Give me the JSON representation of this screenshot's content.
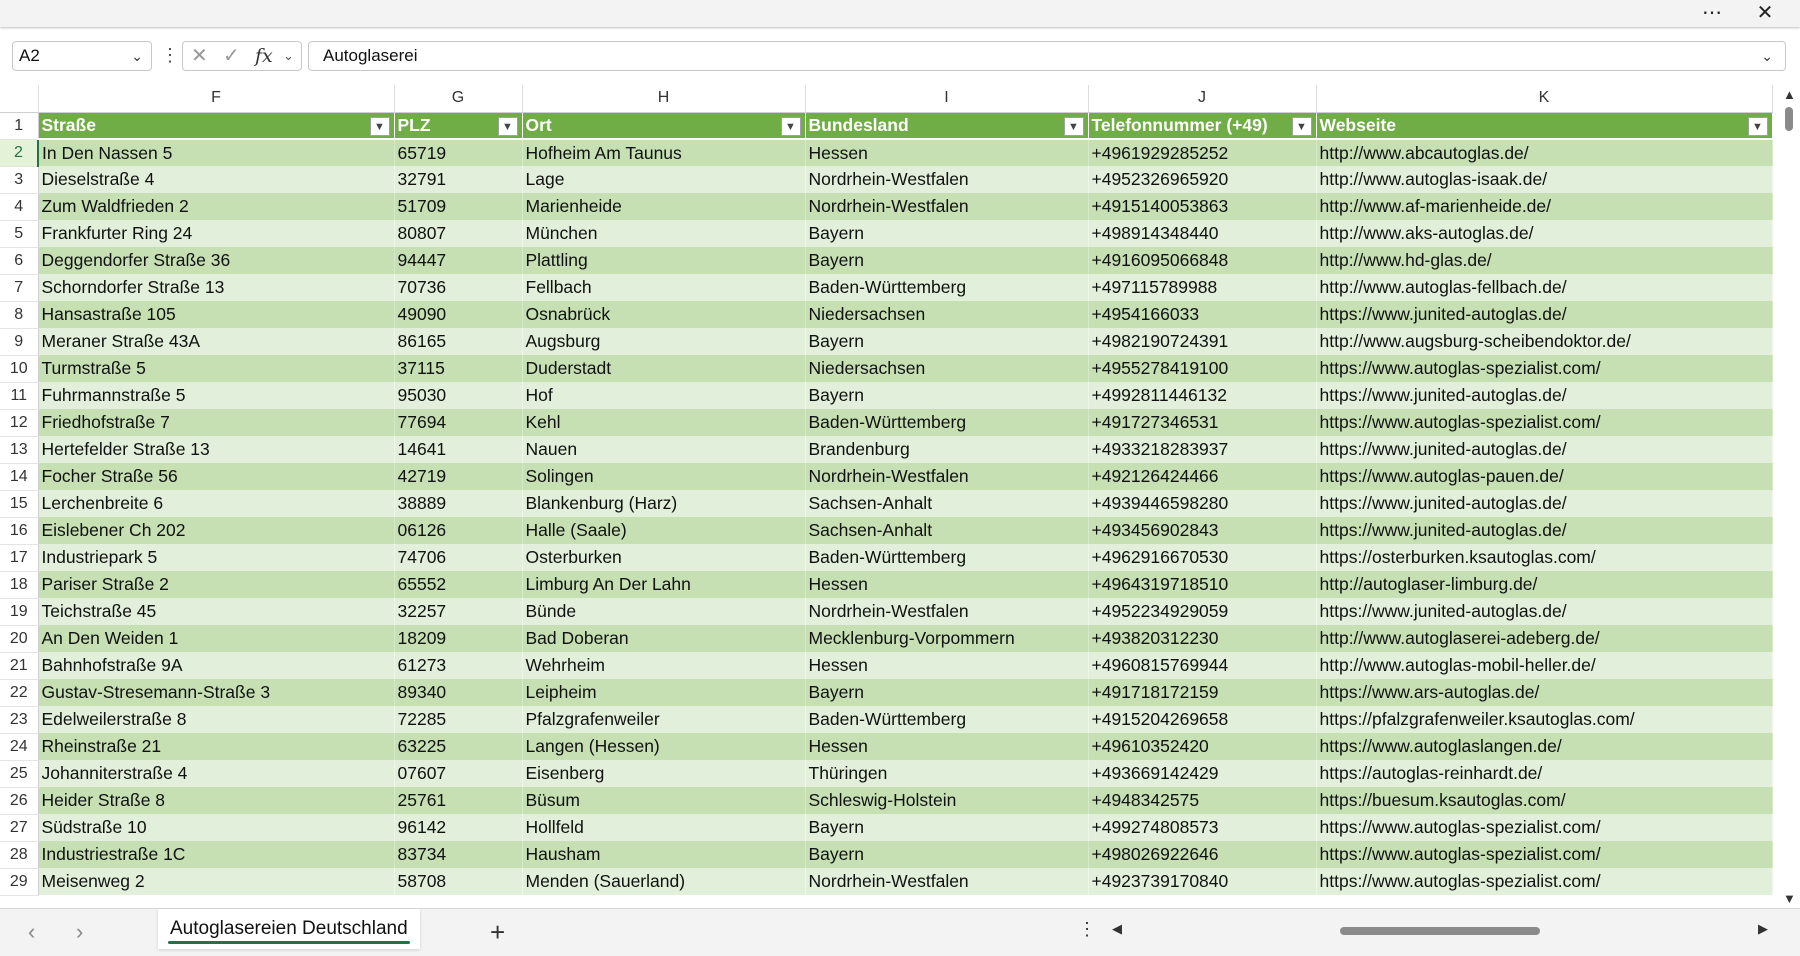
{
  "window": {
    "more_icon": "more-horizontal-icon",
    "close_icon": "close-icon"
  },
  "formula_bar": {
    "name_box": "A2",
    "cancel_icon": "cancel-x-icon",
    "confirm_icon": "checkmark-icon",
    "fx_label": "fx",
    "content": "Autoglaserei"
  },
  "columns": [
    "F",
    "G",
    "H",
    "I",
    "J",
    "K"
  ],
  "headers": [
    "Straße",
    "PLZ",
    "Ort",
    "Bundesland",
    "Telefonnummer (+49)",
    "Webseite"
  ],
  "rows": [
    {
      "n": "2",
      "c": [
        "In Den Nassen 5",
        "65719",
        "Hofheim Am Taunus",
        "Hessen",
        "+4961929285252",
        "http://www.abcautoglas.de/"
      ]
    },
    {
      "n": "3",
      "c": [
        "Dieselstraße 4",
        "32791",
        "Lage",
        "Nordrhein-Westfalen",
        "+4952326965920",
        "http://www.autoglas-isaak.de/"
      ]
    },
    {
      "n": "4",
      "c": [
        "Zum Waldfrieden 2",
        "51709",
        "Marienheide",
        "Nordrhein-Westfalen",
        "+4915140053863",
        "http://www.af-marienheide.de/"
      ]
    },
    {
      "n": "5",
      "c": [
        "Frankfurter Ring 24",
        "80807",
        "München",
        "Bayern",
        "+498914348440",
        "http://www.aks-autoglas.de/"
      ]
    },
    {
      "n": "6",
      "c": [
        "Deggendorfer Straße 36",
        "94447",
        "Plattling",
        "Bayern",
        "+4916095066848",
        "http://www.hd-glas.de/"
      ]
    },
    {
      "n": "7",
      "c": [
        "Schorndorfer Straße 13",
        "70736",
        "Fellbach",
        "Baden-Württemberg",
        "+497115789988",
        "http://www.autoglas-fellbach.de/"
      ]
    },
    {
      "n": "8",
      "c": [
        "Hansastraße 105",
        "49090",
        "Osnabrück",
        "Niedersachsen",
        "+4954166033",
        "https://www.junited-autoglas.de/"
      ]
    },
    {
      "n": "9",
      "c": [
        "Meraner Straße 43A",
        "86165",
        "Augsburg",
        "Bayern",
        "+4982190724391",
        "http://www.augsburg-scheibendoktor.de/"
      ]
    },
    {
      "n": "10",
      "c": [
        "Turmstraße 5",
        "37115",
        "Duderstadt",
        "Niedersachsen",
        "+4955278419100",
        "https://www.autoglas-spezialist.com/"
      ]
    },
    {
      "n": "11",
      "c": [
        "Fuhrmannstraße 5",
        "95030",
        "Hof",
        "Bayern",
        "+4992811446132",
        "https://www.junited-autoglas.de/"
      ]
    },
    {
      "n": "12",
      "c": [
        "Friedhofstraße 7",
        "77694",
        "Kehl",
        "Baden-Württemberg",
        "+491727346531",
        "https://www.autoglas-spezialist.com/"
      ]
    },
    {
      "n": "13",
      "c": [
        "Hertefelder Straße 13",
        "14641",
        "Nauen",
        "Brandenburg",
        "+4933218283937",
        "https://www.junited-autoglas.de/"
      ]
    },
    {
      "n": "14",
      "c": [
        "Focher Straße 56",
        "42719",
        "Solingen",
        "Nordrhein-Westfalen",
        "+492126424466",
        "https://www.autoglas-pauen.de/"
      ]
    },
    {
      "n": "15",
      "c": [
        "Lerchenbreite 6",
        "38889",
        "Blankenburg (Harz)",
        "Sachsen-Anhalt",
        "+4939446598280",
        "https://www.junited-autoglas.de/"
      ]
    },
    {
      "n": "16",
      "c": [
        "Eislebener Ch 202",
        "06126",
        "Halle (Saale)",
        "Sachsen-Anhalt",
        "+493456902843",
        "https://www.junited-autoglas.de/"
      ]
    },
    {
      "n": "17",
      "c": [
        "Industriepark 5",
        "74706",
        "Osterburken",
        "Baden-Württemberg",
        "+4962916670530",
        "https://osterburken.ksautoglas.com/"
      ]
    },
    {
      "n": "18",
      "c": [
        "Pariser Straße 2",
        "65552",
        "Limburg An Der Lahn",
        "Hessen",
        "+4964319718510",
        "http://autoglaser-limburg.de/"
      ]
    },
    {
      "n": "19",
      "c": [
        "Teichstraße 45",
        "32257",
        "Bünde",
        "Nordrhein-Westfalen",
        "+4952234929059",
        "https://www.junited-autoglas.de/"
      ]
    },
    {
      "n": "20",
      "c": [
        "An Den Weiden 1",
        "18209",
        "Bad Doberan",
        "Mecklenburg-Vorpommern",
        "+493820312230",
        "http://www.autoglaserei-adeberg.de/"
      ]
    },
    {
      "n": "21",
      "c": [
        "Bahnhofstraße 9A",
        "61273",
        "Wehrheim",
        "Hessen",
        "+4960815769944",
        "http://www.autoglas-mobil-heller.de/"
      ]
    },
    {
      "n": "22",
      "c": [
        "Gustav-Stresemann-Straße 3",
        "89340",
        "Leipheim",
        "Bayern",
        "+491718172159",
        "https://www.ars-autoglas.de/"
      ]
    },
    {
      "n": "23",
      "c": [
        "Edelweilerstraße 8",
        "72285",
        "Pfalzgrafenweiler",
        "Baden-Württemberg",
        "+4915204269658",
        "https://pfalzgrafenweiler.ksautoglas.com/"
      ]
    },
    {
      "n": "24",
      "c": [
        "Rheinstraße 21",
        "63225",
        "Langen (Hessen)",
        "Hessen",
        "+49610352420",
        "https://www.autoglaslangen.de/"
      ]
    },
    {
      "n": "25",
      "c": [
        "Johanniterstraße 4",
        "07607",
        "Eisenberg",
        "Thüringen",
        "+493669142429",
        "https://autoglas-reinhardt.de/"
      ]
    },
    {
      "n": "26",
      "c": [
        "Heider Straße 8",
        "25761",
        "Büsum",
        "Schleswig-Holstein",
        "+4948342575",
        "https://buesum.ksautoglas.com/"
      ]
    },
    {
      "n": "27",
      "c": [
        "Südstraße 10",
        "96142",
        "Hollfeld",
        "Bayern",
        "+499274808573",
        "https://www.autoglas-spezialist.com/"
      ]
    },
    {
      "n": "28",
      "c": [
        "Industriestraße 1C",
        "83734",
        "Hausham",
        "Bayern",
        "+498026922646",
        "https://www.autoglas-spezialist.com/"
      ]
    },
    {
      "n": "29",
      "c": [
        "Meisenweg 2",
        "58708",
        "Menden (Sauerland)",
        "Nordrhein-Westfalen",
        "+4923739170840",
        "https://www.autoglas-spezialist.com/"
      ]
    }
  ],
  "sheet_tabs": [
    {
      "label": "Autoglasereien Deutschland",
      "active": true
    }
  ],
  "tabbar": {
    "prev_icon": "chevron-left-icon",
    "next_icon": "chevron-right-icon",
    "add_icon": "plus-icon"
  },
  "colors": {
    "header_fill": "#70ad47",
    "band_dark": "#c6e0b4",
    "band_light": "#e2efda",
    "accent": "#217346"
  }
}
